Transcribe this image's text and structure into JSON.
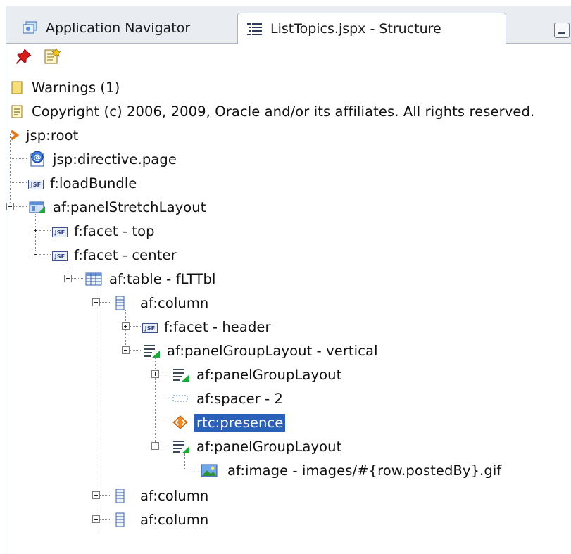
{
  "tabs": {
    "navigator": {
      "label": "Application Navigator",
      "icon": "application-navigator-icon"
    },
    "structure": {
      "label": "ListTopics.jspx - Structure",
      "icon": "structure-icon"
    }
  },
  "toolbar": {
    "pin_icon": "pin-icon",
    "edit_icon": "edit-icon"
  },
  "tree": [
    {
      "label": "Warnings (1)",
      "icon": "warning-note-icon"
    },
    {
      "label": "Copyright (c) 2006, 2009, Oracle and/or its affiliates. All rights reserved.",
      "icon": "comment-icon"
    },
    {
      "label": "jsp:root",
      "icon": "jsp-root-icon"
    },
    {
      "label": "jsp:directive.page",
      "icon": "directive-icon"
    },
    {
      "label": "f:loadBundle",
      "icon": "jsf-icon"
    },
    {
      "label": "af:panelStretchLayout",
      "icon": "panel-stretch-layout-icon"
    },
    {
      "label": "f:facet - top",
      "icon": "jsf-icon"
    },
    {
      "label": "f:facet - center",
      "icon": "jsf-icon"
    },
    {
      "label": "af:table - fLTTbl",
      "icon": "table-icon"
    },
    {
      "label": "af:column",
      "icon": "column-icon"
    },
    {
      "label": "f:facet - header",
      "icon": "jsf-icon"
    },
    {
      "label": "af:panelGroupLayout - vertical",
      "icon": "panel-group-layout-icon"
    },
    {
      "label": "af:panelGroupLayout",
      "icon": "panel-group-layout-icon"
    },
    {
      "label": "af:spacer - 2",
      "icon": "spacer-icon"
    },
    {
      "label": "rtc:presence",
      "icon": "presence-icon",
      "selected": true
    },
    {
      "label": "af:panelGroupLayout",
      "icon": "panel-group-layout-icon"
    },
    {
      "label": "af:image - images/#{row.postedBy}.gif",
      "icon": "image-icon"
    },
    {
      "label": "af:column",
      "icon": "column-icon"
    },
    {
      "label": "af:column",
      "icon": "column-icon"
    }
  ]
}
